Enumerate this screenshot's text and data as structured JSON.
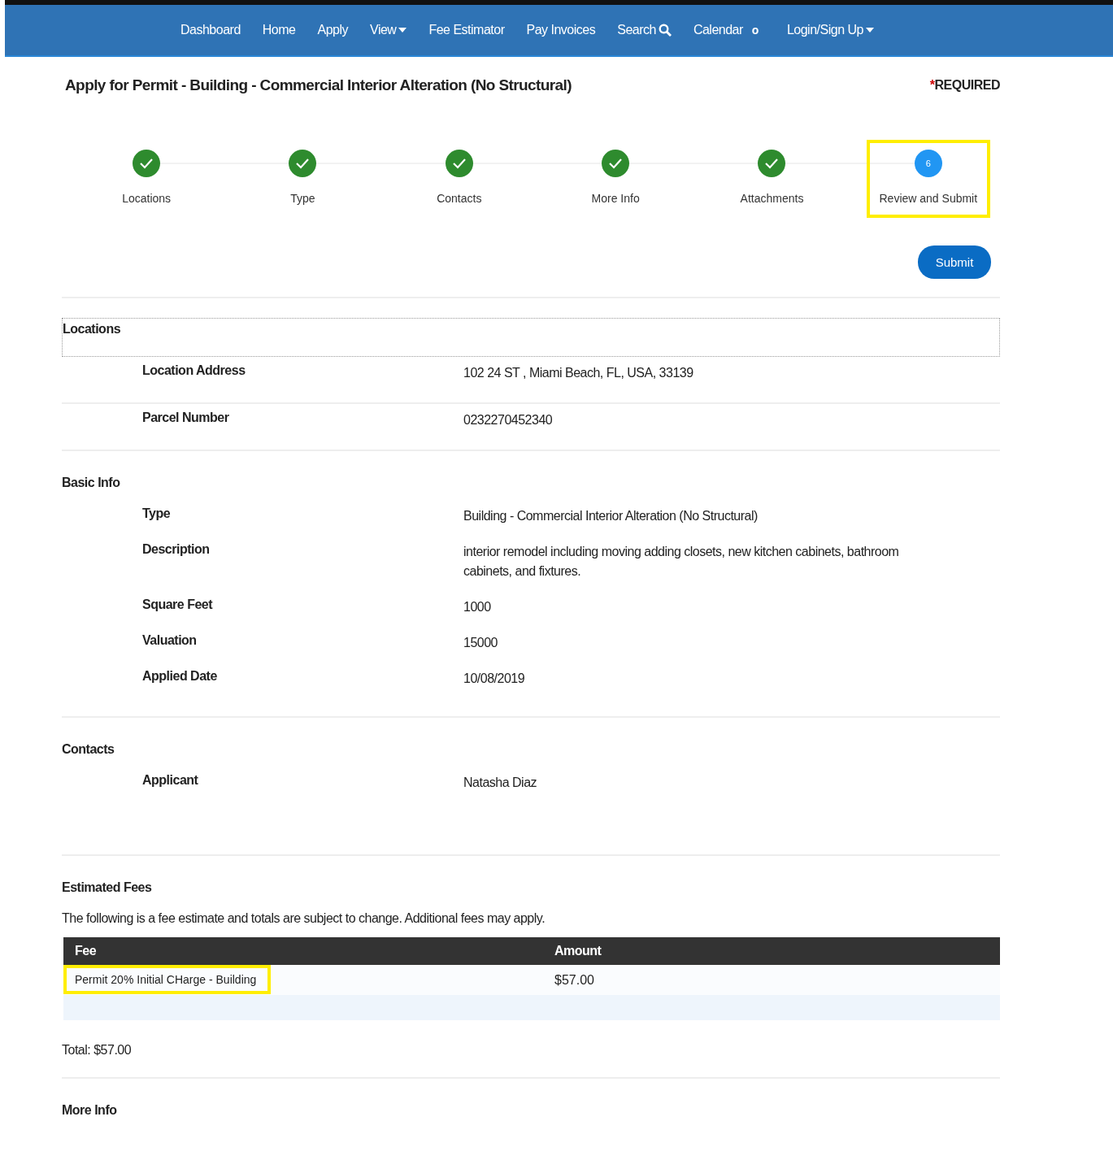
{
  "nav": {
    "items": [
      {
        "label": "Dashboard",
        "kind": "link"
      },
      {
        "label": "Home",
        "kind": "link"
      },
      {
        "label": "Apply",
        "kind": "link"
      },
      {
        "label": "View",
        "kind": "dropdown"
      },
      {
        "label": "Fee Estimator",
        "kind": "link"
      },
      {
        "label": "Pay Invoices",
        "kind": "link"
      },
      {
        "label": "Search",
        "kind": "search"
      },
      {
        "label": "Calendar",
        "kind": "badge",
        "badge": "o"
      },
      {
        "label": "Login/Sign Up",
        "kind": "dropdown"
      }
    ]
  },
  "page": {
    "title": "Apply for Permit - Building - Commercial Interior Alteration (No Structural)",
    "required_mark": "*",
    "required_label": "REQUIRED"
  },
  "steps": [
    {
      "label": "Locations",
      "done": true,
      "selected": false
    },
    {
      "label": "Type",
      "done": true,
      "selected": false
    },
    {
      "label": "Contacts",
      "done": true,
      "selected": false
    },
    {
      "label": "More Info",
      "done": true,
      "selected": false
    },
    {
      "label": "Attachments",
      "done": true,
      "selected": false
    },
    {
      "label": "Review and Submit",
      "done": false,
      "number": "6",
      "selected": true
    }
  ],
  "submit_button": "Submit",
  "sections": [
    {
      "title": "Locations",
      "kind": "fields",
      "boxed": true,
      "fields": [
        {
          "label": "Location Address",
          "value": "102 24 ST , Miami Beach, FL, USA, 33139"
        },
        {
          "label": "Parcel Number",
          "value": "0232270452340"
        }
      ]
    },
    {
      "title": "Basic Info",
      "kind": "fields",
      "boxed": false,
      "fields": [
        {
          "label": "Type",
          "value": "Building - Commercial Interior Alteration (No Structural)"
        },
        {
          "label": "Description",
          "value": "interior remodel including moving adding closets, new kitchen cabinets, bathroom cabinets, and fixtures."
        },
        {
          "label": "Square Feet",
          "value": "1000"
        },
        {
          "label": "Valuation",
          "value": "15000"
        },
        {
          "label": "Applied Date",
          "value": "10/08/2019"
        }
      ]
    },
    {
      "title": "Contacts",
      "kind": "fields",
      "boxed": false,
      "fields": [
        {
          "label": "Applicant",
          "value": "Natasha Diaz"
        }
      ]
    },
    {
      "title": "Estimated Fees",
      "kind": "fees",
      "note": "The following is a fee estimate and totals are subject to change. Additional fees may apply.",
      "columns": [
        "Fee",
        "Amount"
      ],
      "rows": [
        {
          "fee": "Permit 20% Initial CHarge - Building",
          "amount": "$57.00",
          "highlighted": true
        }
      ],
      "total": "Total: $57.00"
    },
    {
      "title": "More Info",
      "kind": "heading"
    }
  ]
}
